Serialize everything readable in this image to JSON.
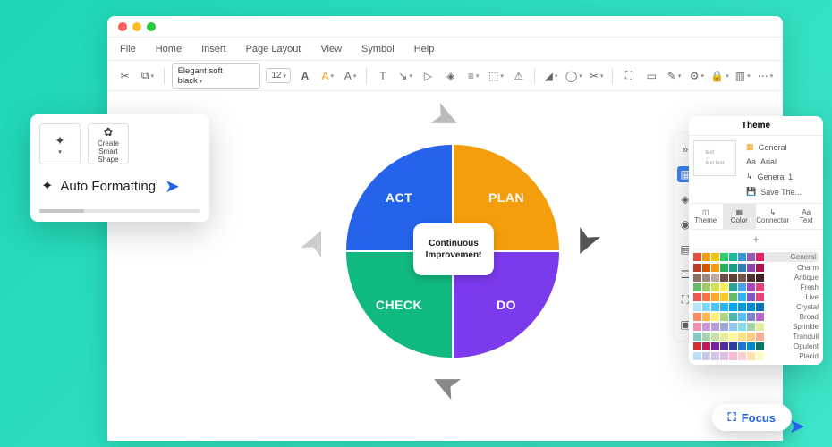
{
  "menubar": [
    "File",
    "Home",
    "Insert",
    "Page Layout",
    "View",
    "Symbol",
    "Help"
  ],
  "toolbar": {
    "font_name": "Elegant soft black",
    "font_size": "12",
    "icons": [
      "cut-icon",
      "copy-icon",
      "format-painter-icon",
      "bold-icon",
      "font-color-icon",
      "highlight-icon",
      "text-icon",
      "line-icon",
      "pointer-icon",
      "layer-icon",
      "align-icon",
      "group-icon",
      "warning-icon",
      "fill-icon",
      "stroke-icon",
      "crop-icon",
      "resize-icon",
      "page-icon",
      "edit-icon",
      "gear-icon",
      "lock-icon",
      "options-icon",
      "more-icon"
    ]
  },
  "diagram": {
    "act": "ACT",
    "plan": "PLAN",
    "check": "CHECK",
    "do": "DO",
    "center1": "Continuous",
    "center2": "Improvement"
  },
  "left_panel": {
    "smart_shape": "Create Smart Shape",
    "auto_format": "Auto Formatting"
  },
  "sidebar_icons": [
    "expand-icon",
    "grid-icon",
    "layers-icon",
    "shapes-icon",
    "document-icon",
    "list-icon",
    "maximize-icon",
    "image-icon"
  ],
  "theme": {
    "title": "Theme",
    "top_items": [
      "General",
      "Arial",
      "General 1",
      "Save The..."
    ],
    "tabs": [
      "Theme",
      "Color",
      "Connector",
      "Text"
    ],
    "palettes": [
      "General",
      "Charm",
      "Antique",
      "Fresh",
      "Live",
      "Crystal",
      "Broad",
      "Sprinkle",
      "Tranquil",
      "Opulent",
      "Placid"
    ]
  },
  "focus": {
    "label": "Focus"
  }
}
